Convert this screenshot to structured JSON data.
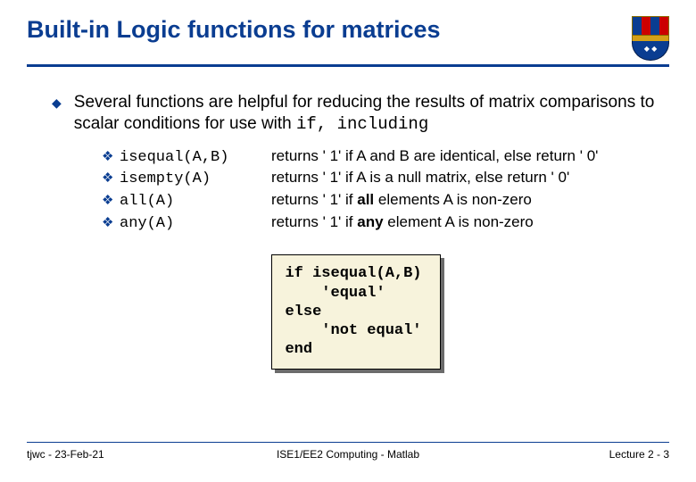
{
  "title": "Built-in Logic functions for matrices",
  "intro_prefix": "Several functions are helpful for reducing the results of matrix comparisons to scalar conditions for use with ",
  "intro_code": "if, including",
  "functions": [
    {
      "code": "isequal(A,B)",
      "desc_pre": "returns ' 1' if A and B are identical, else return ' 0'",
      "bold": ""
    },
    {
      "code": "isempty(A)",
      "desc_pre": "returns ' 1' if A is a null matrix, else return ' 0'",
      "bold": ""
    },
    {
      "code": "all(A)",
      "desc_pre": "returns ' 1' if ",
      "bold": "all",
      "desc_post": " elements A is non-zero"
    },
    {
      "code": "any(A)",
      "desc_pre": "returns ' 1' if ",
      "bold": "any",
      "desc_post": " element A is non-zero"
    }
  ],
  "codebox": "if isequal(A,B)\n    'equal'\nelse\n    'not equal'\nend",
  "footer": {
    "left": "tjwc - 23-Feb-21",
    "center": "ISE1/EE2 Computing - Matlab",
    "right": "Lecture 2 - 3"
  }
}
